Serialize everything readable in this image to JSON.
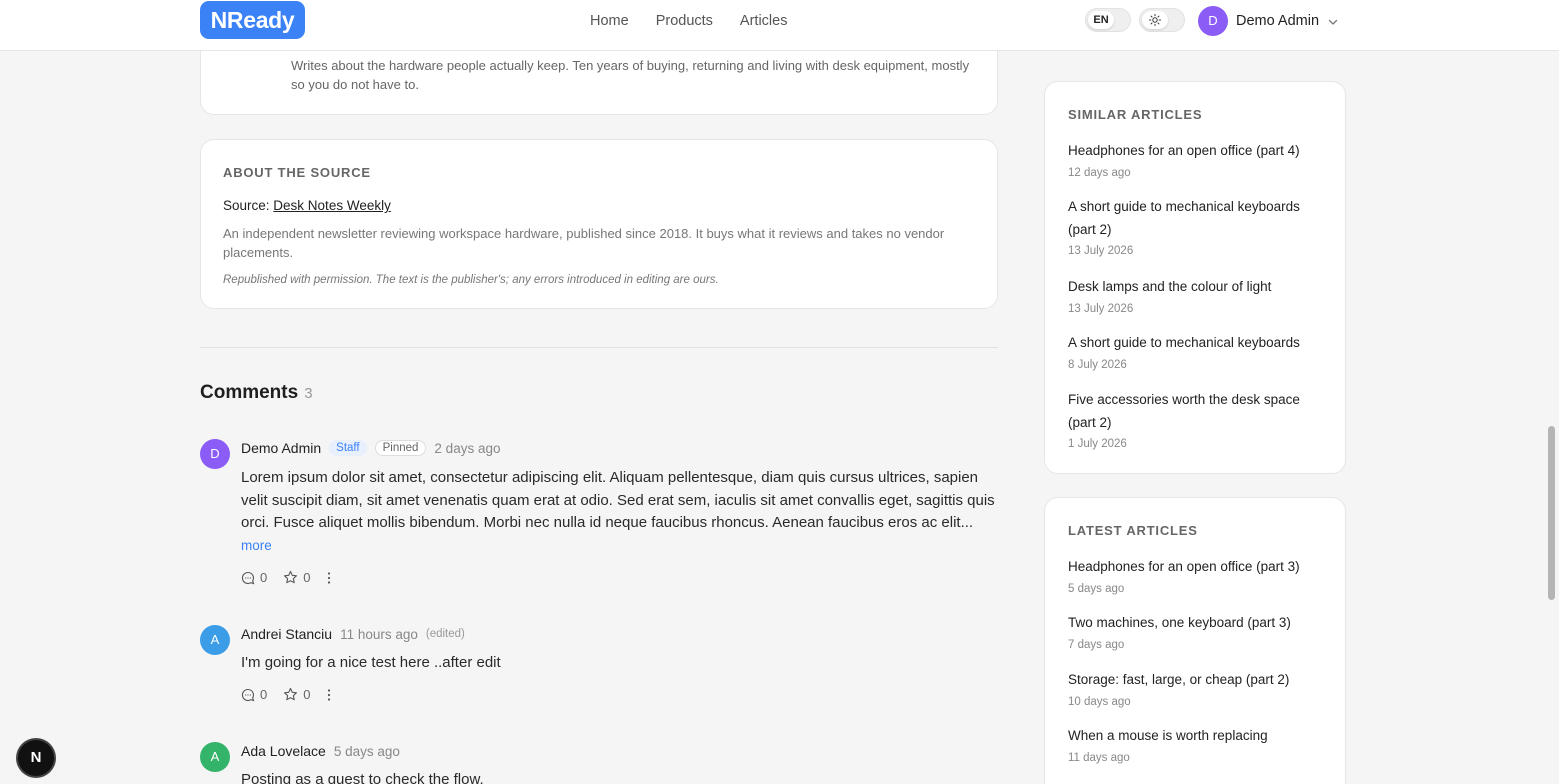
{
  "header": {
    "logo": "NReady",
    "nav": [
      "Home",
      "Products",
      "Articles"
    ],
    "lang": "EN",
    "user": {
      "initial": "D",
      "name": "Demo Admin"
    }
  },
  "author": {
    "bio": "Writes about the hardware people actually keep. Ten years of buying, returning and living with desk equipment, mostly so you do not have to."
  },
  "source": {
    "title": "ABOUT THE SOURCE",
    "prefix": "Source:",
    "name": "Desk Notes Weekly",
    "description": "An independent newsletter reviewing workspace hardware, published since 2018. It buys what it reviews and takes no vendor placements.",
    "note": "Republished with permission. The text is the publisher's; any errors introduced in editing are ours."
  },
  "comments": {
    "title": "Comments",
    "count": "3",
    "items": [
      {
        "initial": "D",
        "color": "#8b5cf6",
        "author": "Demo Admin",
        "staff": "Staff",
        "pinned": "Pinned",
        "time": "2 days ago",
        "body": "Lorem ipsum dolor sit amet, consectetur adipiscing elit. Aliquam pellentesque, diam quis cursus ultrices, sapien velit suscipit diam, sit amet venenatis quam erat at odio. Sed erat sem, iaculis sit amet convallis eget, sagittis quis orci. Fusce aliquet mollis bibendum. Morbi nec nulla id neque faucibus rhoncus. Aenean faucibus eros ac elit...",
        "more": "more",
        "replies": "0",
        "stars": "0"
      },
      {
        "initial": "A",
        "color": "#3b9de8",
        "author": "Andrei Stanciu",
        "time": "11 hours ago",
        "edited": "(edited)",
        "body": "I'm going for a nice test here ..after edit",
        "replies": "0",
        "stars": "0"
      },
      {
        "initial": "A",
        "color": "#34b36b",
        "author": "Ada Lovelace",
        "time": "5 days ago",
        "body": "Posting as a guest to check the flow."
      }
    ]
  },
  "similar": {
    "title": "SIMILAR ARTICLES",
    "items": [
      {
        "title": "Headphones for an open office (part 4)",
        "date": "12 days ago"
      },
      {
        "title": "A short guide to mechanical keyboards (part 2)",
        "date": "13 July 2026"
      },
      {
        "title": "Desk lamps and the colour of light",
        "date": "13 July 2026"
      },
      {
        "title": "A short guide to mechanical keyboards",
        "date": "8 July 2026"
      },
      {
        "title": "Five accessories worth the desk space (part 2)",
        "date": "1 July 2026"
      }
    ]
  },
  "latest": {
    "title": "LATEST ARTICLES",
    "items": [
      {
        "title": "Headphones for an open office (part 3)",
        "date": "5 days ago"
      },
      {
        "title": "Two machines, one keyboard (part 3)",
        "date": "7 days ago"
      },
      {
        "title": "Storage: fast, large, or cheap (part 2)",
        "date": "10 days ago"
      },
      {
        "title": "When a mouse is worth replacing",
        "date": "11 days ago"
      }
    ]
  },
  "floating": {
    "label": "N"
  }
}
